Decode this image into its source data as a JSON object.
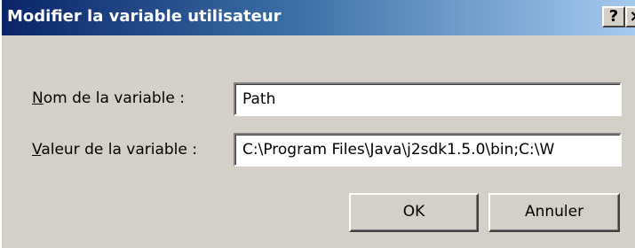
{
  "window": {
    "title": "Modifier la variable utilisateur",
    "help_label": "?",
    "close_label": "×"
  },
  "form": {
    "name_label_mnemonic": "N",
    "name_label_rest": "om de la variable :",
    "name_value": "Path",
    "value_label_mnemonic": "V",
    "value_label_rest": "aleur de la variable :",
    "value_value": "C:\\Program Files\\Java\\j2sdk1.5.0\\bin;C:\\W"
  },
  "buttons": {
    "ok_label": "OK",
    "cancel_label": "Annuler"
  },
  "colors": {
    "titlebar_start": "#0a246a",
    "titlebar_end": "#a6caf0",
    "dialog_face": "#d4d0c8"
  }
}
